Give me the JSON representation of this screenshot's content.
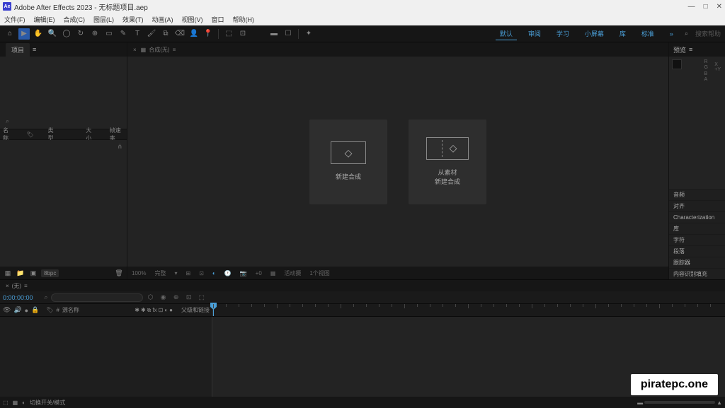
{
  "titlebar": {
    "icon_text": "Ae",
    "title": "Adobe After Effects 2023 - 无标题项目.aep"
  },
  "menubar": {
    "items": [
      "文件(F)",
      "编辑(E)",
      "合成(C)",
      "图层(L)",
      "效果(T)",
      "动画(A)",
      "视图(V)",
      "窗口",
      "帮助(H)"
    ]
  },
  "workspace": {
    "items": [
      "默认",
      "审阅",
      "学习",
      "小屏幕",
      "库",
      "标准"
    ],
    "search_label": "搜索帮助"
  },
  "project": {
    "tab": "项目",
    "search_icon": "⌕",
    "col_name": "名称",
    "col_type": "类型",
    "col_size": "大小",
    "col_frame": "帧速率",
    "footer_dropdown": "8bpc"
  },
  "comp": {
    "tab": "合成(无)",
    "card1_label": "新建合成",
    "card2_line1": "从素材",
    "card2_line2": "新建合成",
    "footer_zoom": "100%",
    "footer_res": "完整",
    "footer_cam": "活动摄",
    "footer_view": "1个视图"
  },
  "right": {
    "tab_preview": "预览",
    "sections": [
      "音频",
      "对齐",
      "Characterization",
      "库",
      "字符",
      "段落",
      "跟踪器",
      "内容识别填充"
    ],
    "x": "X",
    "y": "Y"
  },
  "timeline": {
    "tab": "(无)",
    "timecode": "0:00:00:00",
    "col_source": "源名称",
    "col_parent": "父级和链接",
    "footer_switch": "切换开关/模式"
  },
  "watermark": "piratepc.one"
}
